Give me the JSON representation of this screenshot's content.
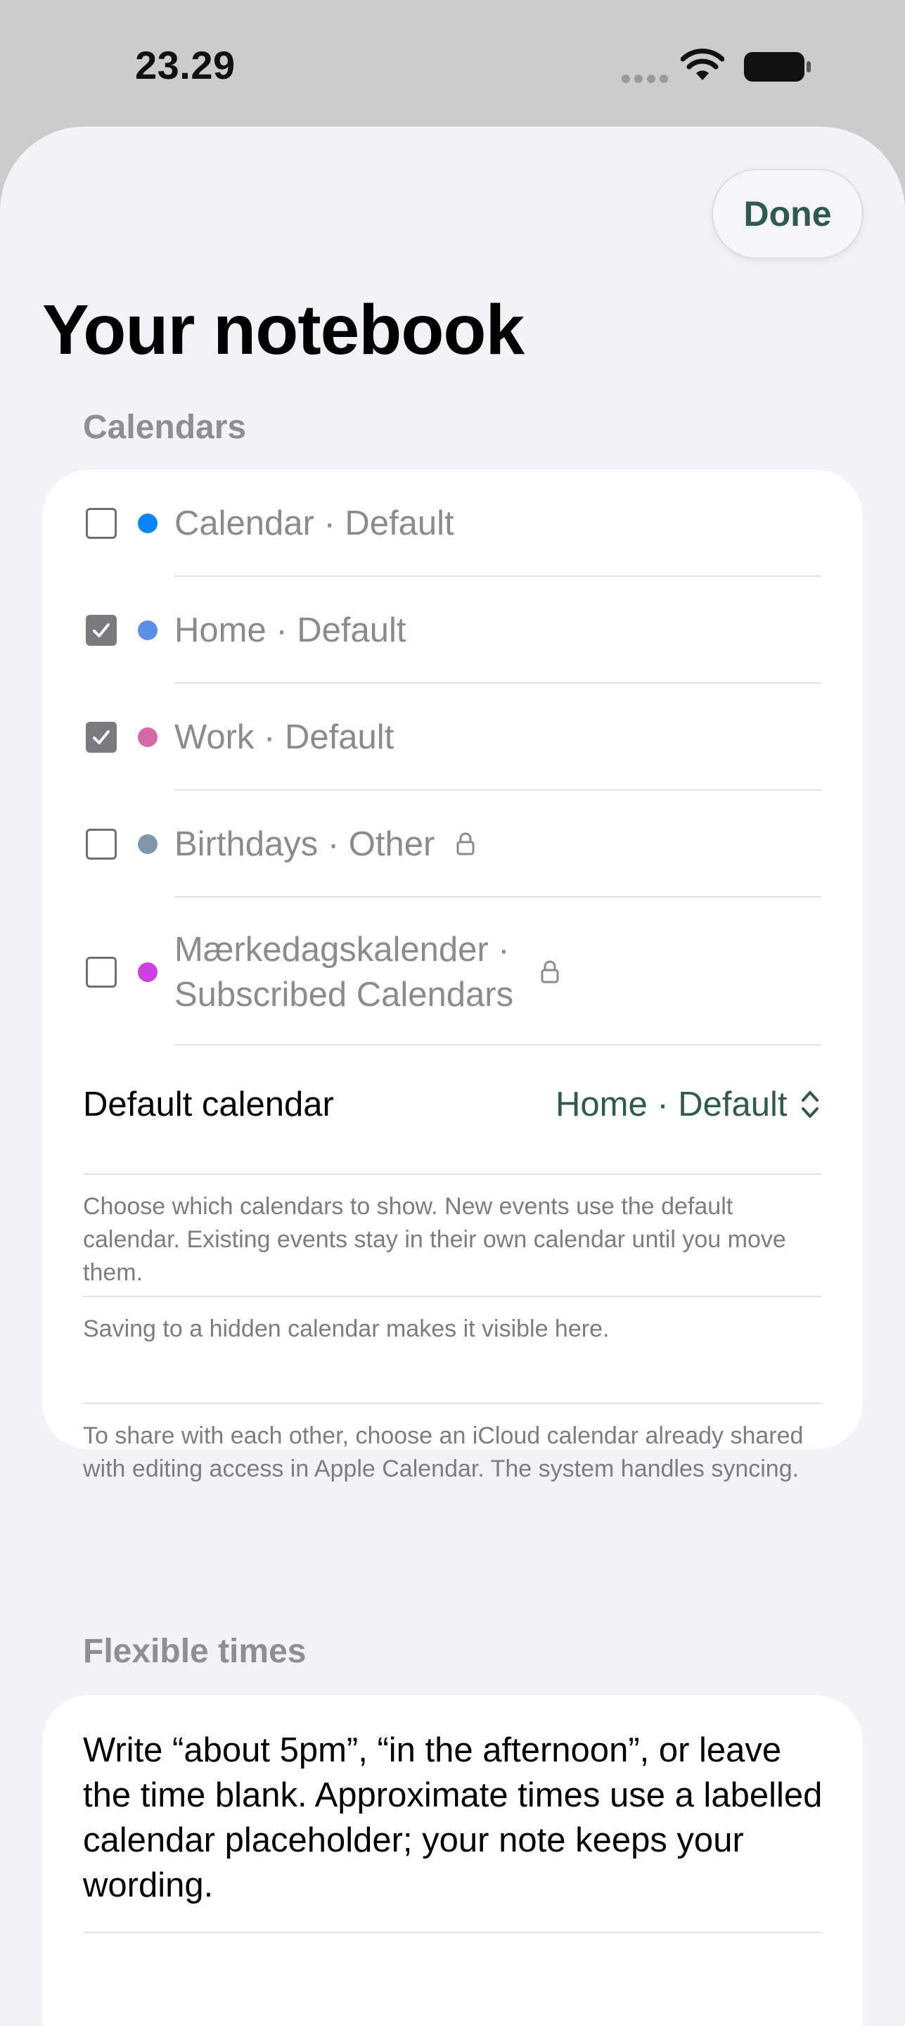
{
  "status_bar": {
    "time": "23.29"
  },
  "sheet": {
    "done_label": "Done",
    "title": "Your notebook"
  },
  "calendars": {
    "header": "Calendars",
    "items": [
      {
        "label": "Calendar · Default",
        "checked": false,
        "color": "#0a84ff",
        "locked": false
      },
      {
        "label": "Home · Default",
        "checked": true,
        "color": "#5b8fe6",
        "locked": false
      },
      {
        "label": "Work · Default",
        "checked": true,
        "color": "#d46aa8",
        "locked": false
      },
      {
        "label": "Birthdays · Other",
        "checked": false,
        "color": "#8096aa",
        "locked": true
      },
      {
        "label_line1": "Mærkedagskalender ·",
        "label_line2": "Subscribed Calendars",
        "checked": false,
        "color": "#cc3fe0",
        "locked": true
      }
    ],
    "default_calendar_label": "Default calendar",
    "default_calendar_value": "Home · Default",
    "notes": [
      "Choose which calendars to show. New events use the default calendar. Existing events stay in their own calendar until you move them.",
      "Saving to a hidden calendar makes it visible here.",
      "To share with each other, choose an iCloud calendar already shared with editing access in Apple Calendar. The system handles syncing."
    ]
  },
  "flexible_times": {
    "header": "Flexible times",
    "text": "Write “about 5pm”, “in the afternoon”, or leave the time blank. Approximate times use a labelled calendar placeholder; your note keeps your wording."
  },
  "colors": {
    "accent": "#2f5a4d",
    "sheet_background": "#f2f2f7",
    "secondary_text": "#8e8e93"
  }
}
